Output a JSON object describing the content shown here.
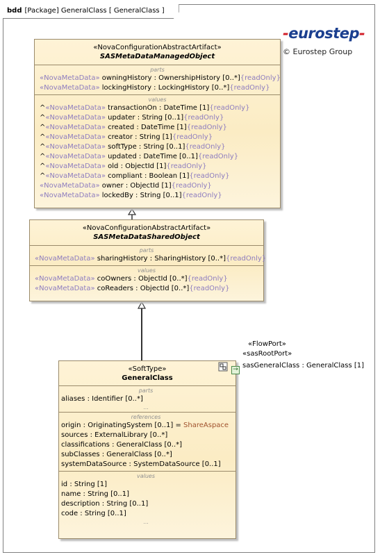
{
  "frame": {
    "kind": "bdd",
    "title": "[Package] GeneralClass [ GeneralClass ]"
  },
  "logo": {
    "text": "eurostep",
    "copyright": "© Eurostep Group"
  },
  "classes": {
    "managed": {
      "stereotype": "«NovaConfigurationAbstractArtifact»",
      "name": "SASMetaDataManagedObject",
      "parts_title": "parts",
      "parts": [
        {
          "st": "«NovaMetaData»",
          "name": "owningHistory",
          "rest": " : OwnershipHistory [0..*]",
          "ro": "{readOnly}"
        },
        {
          "st": "«NovaMetaData»",
          "name": "lockingHistory",
          "rest": " : LockingHistory [0..*]",
          "ro": "{readOnly}"
        }
      ],
      "values_title": "values",
      "values": [
        {
          "pre": "^",
          "st": "«NovaMetaData»",
          "name": "transactionOn",
          "rest": " : DateTime [1]",
          "ro": "{readOnly}"
        },
        {
          "pre": "^",
          "st": "«NovaMetaData»",
          "name": "updater",
          "rest": " : String [0..1]",
          "ro": "{readOnly}"
        },
        {
          "pre": "^",
          "st": "«NovaMetaData»",
          "name": "created",
          "rest": " : DateTime [1]",
          "ro": "{readOnly}"
        },
        {
          "pre": "^",
          "st": "«NovaMetaData»",
          "name": "creator",
          "rest": " : String [1]",
          "ro": "{readOnly}"
        },
        {
          "pre": "^",
          "st": "«NovaMetaData»",
          "name": "softType",
          "rest": " : String [0..1]",
          "ro": "{readOnly}"
        },
        {
          "pre": "^",
          "st": "«NovaMetaData»",
          "name": "updated",
          "rest": " : DateTime [0..1]",
          "ro": "{readOnly}"
        },
        {
          "pre": "^",
          "st": "«NovaMetaData»",
          "name": "old",
          "rest": " : ObjectId [1]",
          "ro": "{readOnly}"
        },
        {
          "pre": "^",
          "st": "«NovaMetaData»",
          "name": "compliant",
          "rest": " : Boolean [1]",
          "ro": "{readOnly}"
        },
        {
          "pre": "",
          "st": "«NovaMetaData»",
          "name": "owner",
          "rest": " : ObjectId [1]",
          "ro": "{readOnly}"
        },
        {
          "pre": "",
          "st": "«NovaMetaData»",
          "name": "lockedBy",
          "rest": " : String [0..1]",
          "ro": "{readOnly}"
        }
      ]
    },
    "shared": {
      "stereotype": "«NovaConfigurationAbstractArtifact»",
      "name": "SASMetaDataSharedObject",
      "parts_title": "parts",
      "parts": [
        {
          "st": "«NovaMetaData»",
          "name": "sharingHistory",
          "rest": " : SharingHistory [0..*]",
          "ro": "{readOnly}"
        }
      ],
      "values_title": "values",
      "values": [
        {
          "st": "«NovaMetaData»",
          "name": "coOwners",
          "rest": " : ObjectId [0..*]",
          "ro": "{readOnly}"
        },
        {
          "st": "«NovaMetaData»",
          "name": "coReaders",
          "rest": " : ObjectId [0..*]",
          "ro": "{readOnly}"
        }
      ]
    },
    "general": {
      "stereotype": "«SoftType»",
      "name": "GeneralClass",
      "parts_title": "parts",
      "parts": [
        {
          "name": "aliases",
          "rest": " : Identifier [0..*]"
        }
      ],
      "ellipsis": "...",
      "references_title": "references",
      "references": [
        {
          "name": "origin",
          "rest": " : OriginatingSystem [0..1] = ",
          "link": "ShareAspace"
        },
        {
          "name": "sources",
          "rest": " : ExternalLibrary [0..*]",
          "link": ""
        },
        {
          "name": "classifications",
          "rest": " : GeneralClass [0..*]",
          "link": ""
        },
        {
          "name": "subClasses",
          "rest": " : GeneralClass [0..*]",
          "link": ""
        },
        {
          "name": "systemDataSource",
          "rest": " : SystemDataSource [0..1]",
          "link": ""
        }
      ],
      "values_title": "values",
      "values": [
        {
          "name": "id",
          "rest": " : String [1]"
        },
        {
          "name": "name",
          "rest": " : String [0..1]"
        },
        {
          "name": "description",
          "rest": " : String [0..1]"
        },
        {
          "name": "code",
          "rest": " : String [0..1]"
        }
      ]
    }
  },
  "port": {
    "stereotype1": "«FlowPort»",
    "stereotype2": "«sasRootPort»",
    "label": "sasGeneralClass : GeneralClass [1]"
  }
}
